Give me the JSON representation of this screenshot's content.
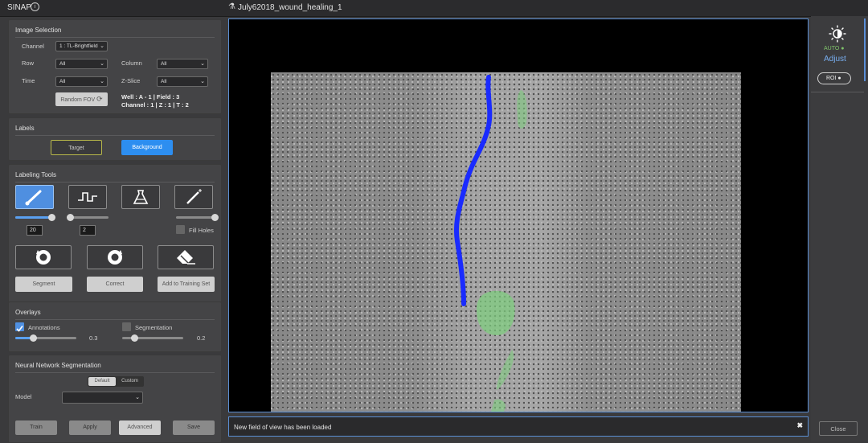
{
  "app": {
    "title": "SINAP",
    "file_title": "July62018_wound_healing_1"
  },
  "image_selection": {
    "title": "Image Selection",
    "channel_label": "Channel",
    "channel_value": "1 : TL-Brightfield",
    "row_label": "Row",
    "row_value": "All",
    "column_label": "Column",
    "column_value": "All",
    "time_label": "Time",
    "time_value": "All",
    "zslice_label": "Z-Slice",
    "zslice_value": "All",
    "random_fov_label": "Random FOV",
    "info_line1": "Well : A - 1 |   Field : 3",
    "info_line2": "Channel : 1 |  Z : 1   | T : 2"
  },
  "labels": {
    "title": "Labels",
    "target": "Target",
    "background": "Background"
  },
  "labeling_tools": {
    "title": "Labeling Tools",
    "brush_size": "20",
    "step_size": "2",
    "brush_level": 0.95,
    "step_level": 0.0,
    "wand_level": 1.0,
    "fill_holes": "Fill Holes",
    "segment": "Segment",
    "correct": "Correct",
    "add_training": "Add to Training Set"
  },
  "overlays": {
    "title": "Overlays",
    "annotations_label": "Annotations",
    "annotations_value": "0.3",
    "annotations_level": 0.3,
    "segmentation_label": "Segmentation",
    "segmentation_value": "0.2",
    "segmentation_level": 0.2
  },
  "nn": {
    "title": "Neural Network Segmentation",
    "tab_default": "Default",
    "tab_custom": "Custom",
    "model_label": "Model",
    "model_value": "",
    "train": "Train",
    "apply": "Apply",
    "advanced": "Advanced",
    "save": "Save"
  },
  "right": {
    "auto": "AUTO",
    "adjust": "Adjust",
    "roi": "ROI"
  },
  "status": {
    "message": "New field of view has been loaded",
    "close": "Close"
  },
  "colors": {
    "accent": "#4f8fe0",
    "annotation_blue": "#1a2bff",
    "segment_green": "#7ed07e",
    "auto_green": "#7fc36a"
  }
}
